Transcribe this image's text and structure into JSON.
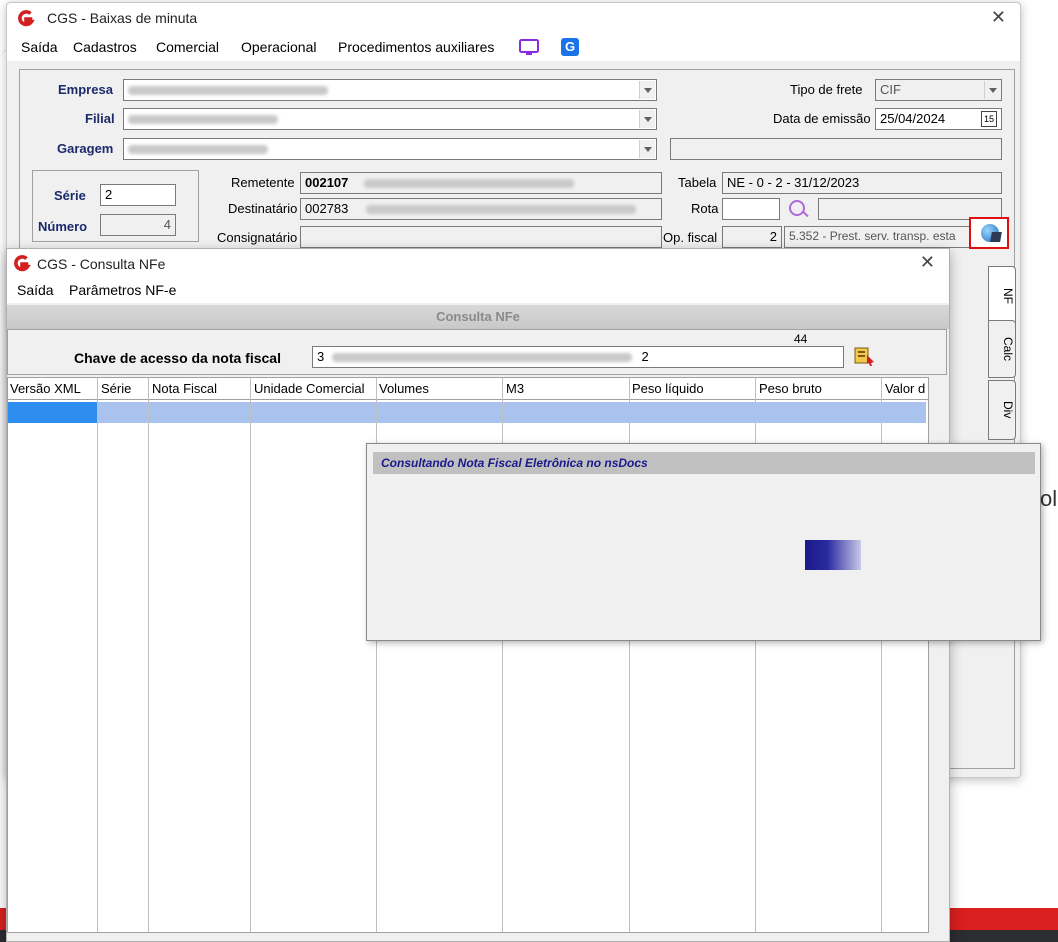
{
  "main_window": {
    "title": "CGS - Baixas de minuta",
    "menu": [
      "Saída",
      "Cadastros",
      "Comercial",
      "Operacional",
      "Procedimentos auxiliares"
    ],
    "empresa_label": "Empresa",
    "filial_label": "Filial",
    "garagem_label": "Garagem",
    "tipo_frete_label": "Tipo de frete",
    "tipo_frete_value": "CIF",
    "data_emissao_label": "Data de emissão",
    "data_emissao_value": "25/04/2024",
    "calendar_icon_text": "15",
    "serie_label": "Série",
    "serie_value": "2",
    "numero_label": "Número",
    "numero_value": "4",
    "remetente_label": "Remetente",
    "remetente_code": "002107",
    "destinatario_label": "Destinatário",
    "destinatario_code": "002783",
    "consignatario_label": "Consignatário",
    "tabela_label": "Tabela",
    "tabela_value": "NE - 0 - 2 - 31/12/2023",
    "rota_label": "Rota",
    "op_fiscal_label": "Op. fiscal",
    "op_fiscal_code": "2",
    "op_fiscal_desc": "5.352 - Prest. serv. transp. esta",
    "tabs": [
      "NF",
      "Calc",
      "Div"
    ]
  },
  "nfe_window": {
    "title": "CGS - Consulta NFe",
    "menu": [
      "Saída",
      "Parâmetros NF-e"
    ],
    "header": "Consulta NFe",
    "chave_label": "Chave de acesso da nota fiscal",
    "chave_count": "44",
    "chave_prefix": "3",
    "chave_suffix": "2",
    "columns": [
      "Versão XML",
      "Série",
      "Nota Fiscal",
      "Unidade Comercial",
      "Volumes",
      "M3",
      "Peso líquido",
      "Peso bruto",
      "Valor d"
    ]
  },
  "progress_dialog": {
    "title": "Consultando Nota Fiscal Eletrônica no nsDocs"
  },
  "background_text": "ol",
  "colors": {
    "accent_red": "#d91f1f",
    "label_blue": "#1a2a6a",
    "selection_blue": "#a9c3ee",
    "progress_blue": "#1a1a8a"
  }
}
